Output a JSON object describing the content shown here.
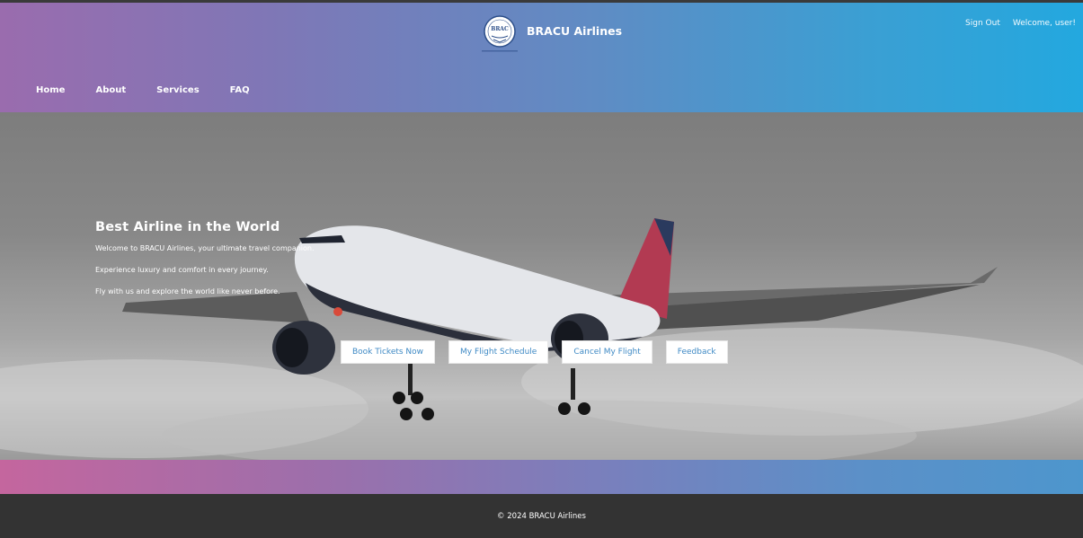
{
  "header": {
    "brand_name": "BRACU Airlines",
    "logo_text": "BRAC",
    "auth": {
      "sign_out_label": "Sign Out",
      "welcome_text": "Welcome, user!"
    },
    "nav": [
      {
        "label": "Home"
      },
      {
        "label": "About"
      },
      {
        "label": "Services"
      },
      {
        "label": "FAQ"
      }
    ]
  },
  "hero": {
    "title": "Best Airline in the World",
    "lines": [
      "Welcome to BRACU Airlines, your ultimate travel companion.",
      "Experience luxury and comfort in every journey.",
      "Fly with us and explore the world like never before."
    ],
    "buttons": [
      {
        "label": "Book Tickets Now"
      },
      {
        "label": "My Flight Schedule"
      },
      {
        "label": "Cancel My Flight"
      },
      {
        "label": "Feedback"
      }
    ],
    "image_subject": "airplane-photo"
  },
  "footer": {
    "copyright": "© 2024 BRACU Airlines"
  },
  "colors": {
    "header_gradient_start": "#9a6cae",
    "header_gradient_end": "#23a8df",
    "button_text": "#3f8ac5",
    "footer_bg": "#333333",
    "band_gradient_start": "#c4669e",
    "band_gradient_end": "#4d96cd"
  }
}
